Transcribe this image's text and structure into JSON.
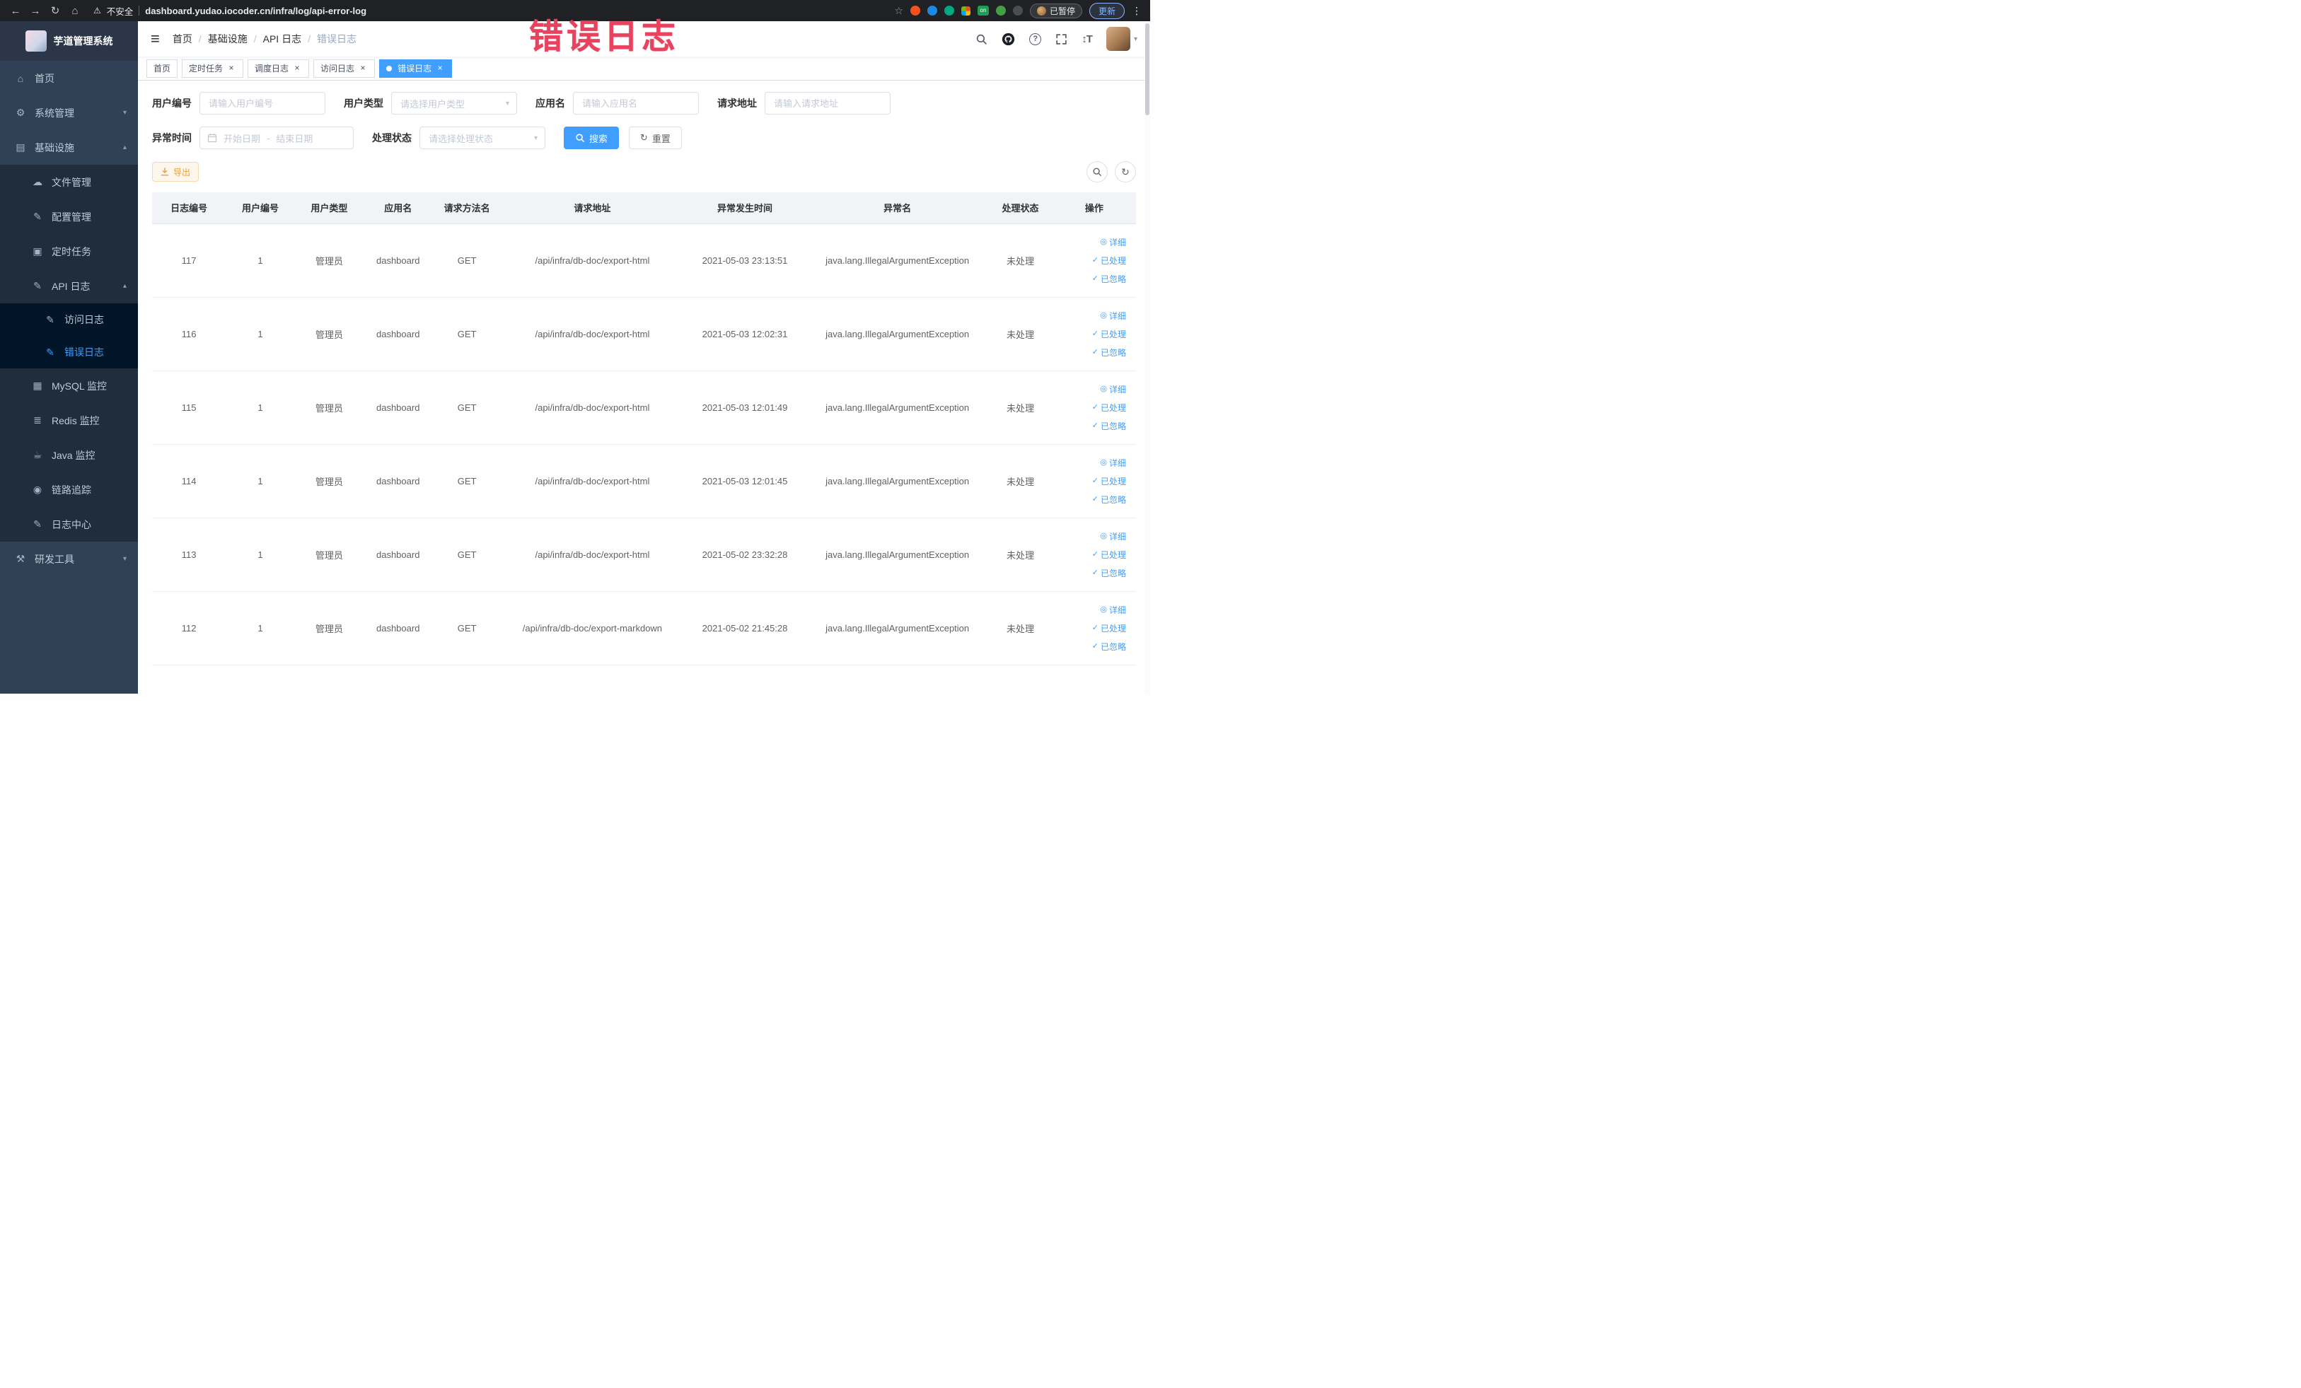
{
  "annotation": {
    "text": "错误日志"
  },
  "icons": {
    "back": "←",
    "forward": "→",
    "reload": "↻",
    "home": "⌂",
    "warning": "⚠",
    "star": "☆",
    "overflow": "⋮",
    "hamburger": "≡",
    "gear": "⚙",
    "monitor": "▤",
    "cloud": "☁",
    "edit": "✎",
    "task": "▣",
    "image": "▦",
    "stack": "≣",
    "coffee": "☕",
    "eye_big": "◉",
    "tools": "⚒",
    "chevron_down": "▾",
    "chevron_up": "▴",
    "caret_down": "▾",
    "close": "×",
    "check": "✓",
    "eye": "◎",
    "question": "?",
    "refresh": "↻"
  },
  "browser": {
    "security_label": "不安全",
    "url": "dashboard.yudao.iocoder.cn/infra/log/api-error-log",
    "on_badge": "on",
    "paused_badge": "已暂停",
    "update_label": "更新"
  },
  "sidebar": {
    "logo_title": "芋道管理系统",
    "items": [
      {
        "label": "首页"
      },
      {
        "label": "系统管理"
      },
      {
        "label": "基础设施"
      },
      {
        "label": "文件管理"
      },
      {
        "label": "配置管理"
      },
      {
        "label": "定时任务"
      },
      {
        "label": "API 日志"
      },
      {
        "label": "访问日志"
      },
      {
        "label": "错误日志"
      },
      {
        "label": "MySQL 监控"
      },
      {
        "label": "Redis 监控"
      },
      {
        "label": "Java 监控"
      },
      {
        "label": "链路追踪"
      },
      {
        "label": "日志中心"
      },
      {
        "label": "研发工具"
      }
    ]
  },
  "breadcrumb": {
    "separator": "/",
    "items": [
      "首页",
      "基础设施",
      "API 日志",
      "错误日志"
    ]
  },
  "tabs": [
    {
      "label": "首页"
    },
    {
      "label": "定时任务"
    },
    {
      "label": "调度日志"
    },
    {
      "label": "访问日志"
    },
    {
      "label": "错误日志"
    }
  ],
  "filters": {
    "user_id_label": "用户编号",
    "user_id_placeholder": "请输入用户编号",
    "user_type_label": "用户类型",
    "user_type_placeholder": "请选择用户类型",
    "app_name_label": "应用名",
    "app_name_placeholder": "请输入应用名",
    "request_url_label": "请求地址",
    "request_url_placeholder": "请输入请求地址",
    "exception_time_label": "异常时间",
    "start_date_placeholder": "开始日期",
    "range_separator": "-",
    "end_date_placeholder": "结束日期",
    "process_status_label": "处理状态",
    "process_status_placeholder": "请选择处理状态",
    "search_label": "搜索",
    "reset_label": "重置"
  },
  "toolbar": {
    "export_label": "导出"
  },
  "table": {
    "columns": [
      "日志编号",
      "用户编号",
      "用户类型",
      "应用名",
      "请求方法名",
      "请求地址",
      "异常发生时间",
      "异常名",
      "处理状态",
      "操作"
    ],
    "row_actions": {
      "detail": "详细",
      "processed": "已处理",
      "ignored": "已忽略"
    },
    "rows": [
      {
        "log_id": "117",
        "user_id": "1",
        "user_type": "管理员",
        "app_name": "dashboard",
        "method": "GET",
        "url": "/api/infra/db-doc/export-html",
        "time": "2021-05-03 23:13:51",
        "exception": "java.lang.IllegalArgumentException",
        "status": "未处理"
      },
      {
        "log_id": "116",
        "user_id": "1",
        "user_type": "管理员",
        "app_name": "dashboard",
        "method": "GET",
        "url": "/api/infra/db-doc/export-html",
        "time": "2021-05-03 12:02:31",
        "exception": "java.lang.IllegalArgumentException",
        "status": "未处理"
      },
      {
        "log_id": "115",
        "user_id": "1",
        "user_type": "管理员",
        "app_name": "dashboard",
        "method": "GET",
        "url": "/api/infra/db-doc/export-html",
        "time": "2021-05-03 12:01:49",
        "exception": "java.lang.IllegalArgumentException",
        "status": "未处理"
      },
      {
        "log_id": "114",
        "user_id": "1",
        "user_type": "管理员",
        "app_name": "dashboard",
        "method": "GET",
        "url": "/api/infra/db-doc/export-html",
        "time": "2021-05-03 12:01:45",
        "exception": "java.lang.IllegalArgumentException",
        "status": "未处理"
      },
      {
        "log_id": "113",
        "user_id": "1",
        "user_type": "管理员",
        "app_name": "dashboard",
        "method": "GET",
        "url": "/api/infra/db-doc/export-html",
        "time": "2021-05-02 23:32:28",
        "exception": "java.lang.IllegalArgumentException",
        "status": "未处理"
      },
      {
        "log_id": "112",
        "user_id": "1",
        "user_type": "管理员",
        "app_name": "dashboard",
        "method": "GET",
        "url": "/api/infra/db-doc/export-markdown",
        "time": "2021-05-02 21:45:28",
        "exception": "java.lang.IllegalArgumentException",
        "status": "未处理"
      }
    ]
  },
  "colors": {
    "accent": "#409eff",
    "sidebar_bg": "#304156",
    "annotation": "#e8425e",
    "warning_button": "#e6a23c"
  }
}
